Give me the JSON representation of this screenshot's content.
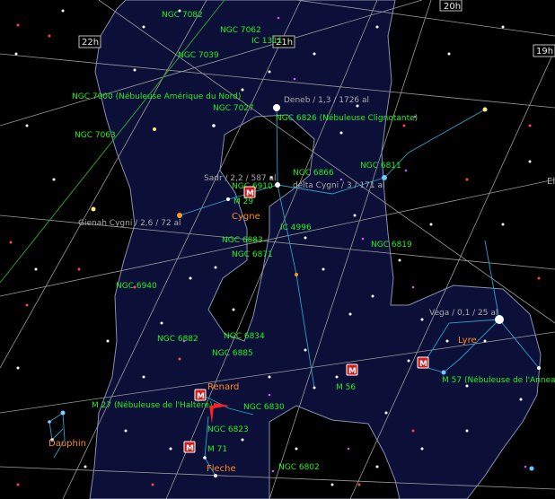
{
  "colors": {
    "background": "#000000",
    "milky_way": "#0c1038",
    "milky_way_edge": "#8890b0",
    "grid": "#9a9a9a",
    "ecliptic": "#2aa02a",
    "constellation_lines": "#2aa0c8",
    "ngc_label": "#22ee22",
    "constellation_label": "#ff8822",
    "star_label": "#aaaaaa",
    "messier_marker": "#d41a1a"
  },
  "ra_labels": {
    "h20": "20h",
    "h21": "21h",
    "h22": "22h",
    "h19": "19h"
  },
  "edge_label": "El",
  "constellations": {
    "cygne": "Cygne",
    "lyre": "Lyre",
    "renard": "Renard",
    "dauphin": "Dauphin",
    "fleche": "Fleche"
  },
  "stars": {
    "deneb": "Deneb / 1,3 / 1726 al",
    "sadr": "Sadr / 2,2 / 587 al",
    "delta_cygni": "delta Cygni / 3 / 171 al",
    "gienah": "Gienah Cygni / 2,6 / 72 al",
    "vega": "Vega / 0,1 / 25 al"
  },
  "objects": {
    "ngc7082": "NGC 7082",
    "ngc7062": "NGC 7062",
    "ic1311": "IC 1311",
    "ngc7039": "NGC 7039",
    "ngc7000": "NGC 7000 (Nébuleuse Amérique du Nord)",
    "ngc7027": "NGC 7027",
    "ngc7063": "NGC 7063",
    "ngc6826": "NGC 6826 (Nébuleuse Clignotante)",
    "ngc6866": "NGC 6866",
    "ngc6811": "NGC 6811",
    "ngc6910": "NGC 6910",
    "m29": "M 29",
    "ic4996": "IC 4996",
    "ngc6883": "NGC 6883",
    "ngc6871": "NGC 6871",
    "ngc6819": "NGC 6819",
    "ngc6940": "NGC 6940",
    "ngc6882": "NGC 6882",
    "ngc6834": "NGC 6834",
    "ngc6885": "NGC 6885",
    "m56": "M 56",
    "m57": "M 57 (Nébuleuse de l'Anneau)",
    "m27": "M 27 (Nébuleuse de l'Haltère)",
    "ngc6830": "NGC 6830",
    "ngc6823": "NGC 6823",
    "m71": "M 71",
    "ngc6802": "NGC 6802"
  },
  "messier_marker_letter": "M"
}
